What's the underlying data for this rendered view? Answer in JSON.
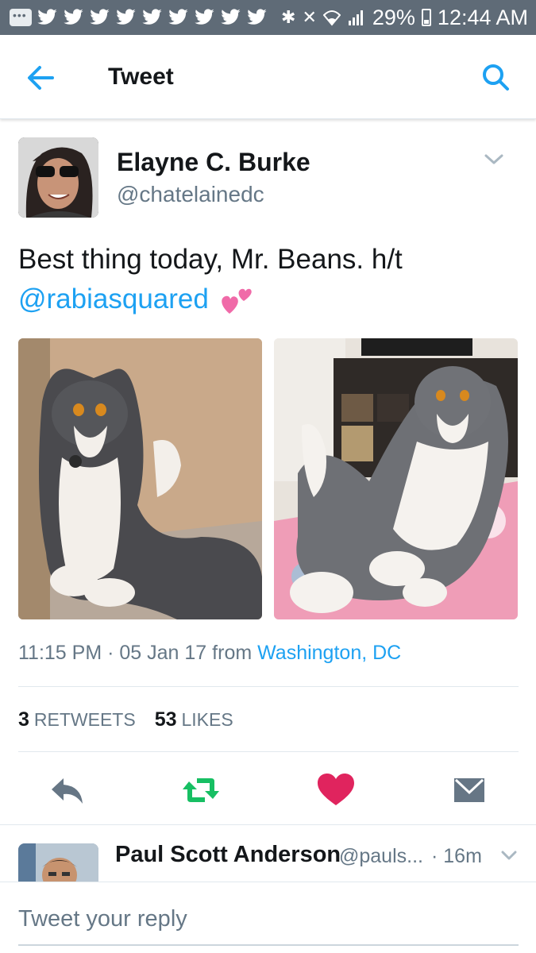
{
  "status_bar": {
    "battery": "29%",
    "time": "12:44 AM",
    "icons": [
      "message-icon",
      "twitter-bird-icon",
      "bluetooth-icon",
      "mute-icon",
      "wifi-icon",
      "signal-icon",
      "battery-icon"
    ]
  },
  "app_bar": {
    "title": "Tweet",
    "back_icon": "arrow-left-icon",
    "search_icon": "search-icon"
  },
  "tweet": {
    "author_name": "Elayne C. Burke",
    "author_handle": "@chatelainedc",
    "text_line1": "Best thing today, Mr. Beans. h/t",
    "mention": "@rabiasquared",
    "emoji": "two-hearts-emoji",
    "time": "11:15 PM",
    "date": "05 Jan 17",
    "from_label": "from",
    "location": "Washington, DC",
    "retweets_count": "3",
    "retweets_label": "RETWEETS",
    "likes_count": "53",
    "likes_label": "LIKES",
    "photos": [
      "cat-photo-sitting",
      "cat-photo-on-blanket"
    ]
  },
  "actions": [
    "reply-icon",
    "retweet-icon",
    "like-heart-icon",
    "direct-message-icon"
  ],
  "colors": {
    "accent": "#1da1f2",
    "retweet": "#17bf63",
    "like": "#e0245e",
    "muted": "#657786",
    "status_bar": "#5f6b77"
  },
  "reply": {
    "name": "Paul Scott Anderson",
    "handle": "@pauls...",
    "time": "· 16m"
  },
  "compose": {
    "placeholder": "Tweet your reply"
  }
}
